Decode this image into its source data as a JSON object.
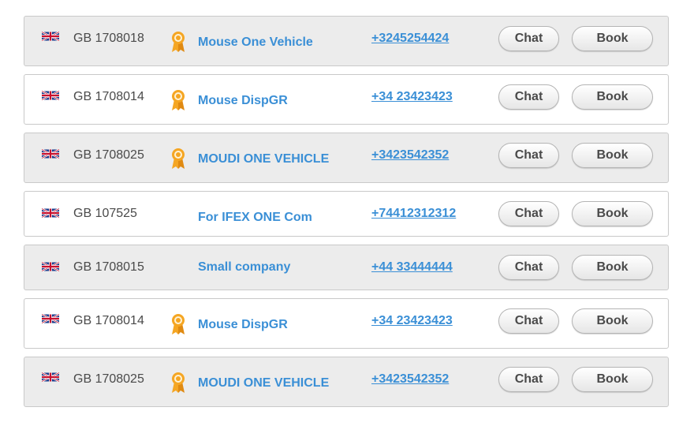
{
  "colors": {
    "link": "#3a8fd6",
    "row_gray": "#ececec",
    "row_white": "#ffffff",
    "medal": "#f5a623"
  },
  "icons": {
    "flag": "uk-flag-icon",
    "badge": "award-medal-icon"
  },
  "rows": [
    {
      "code": "GB 1708018",
      "company": "Mouse One Vehicle",
      "phone": "+3245254424",
      "has_medal": true,
      "chat_label": "Chat",
      "book_label": "Book"
    },
    {
      "code": "GB 1708014",
      "company": "Mouse DispGR",
      "phone": "+34 23423423",
      "has_medal": true,
      "chat_label": "Chat",
      "book_label": "Book"
    },
    {
      "code": "GB 1708025",
      "company": "MOUDI ONE VEHICLE",
      "phone": "+3423542352",
      "has_medal": true,
      "chat_label": "Chat",
      "book_label": "Book"
    },
    {
      "code": "GB 107525",
      "company": "For IFEX ONE Com",
      "phone": "+74412312312",
      "has_medal": false,
      "chat_label": "Chat",
      "book_label": "Book"
    },
    {
      "code": "GB 1708015",
      "company": "Small company",
      "phone": "+44 33444444",
      "has_medal": false,
      "chat_label": "Chat",
      "book_label": "Book"
    },
    {
      "code": "GB 1708014",
      "company": "Mouse DispGR",
      "phone": "+34 23423423",
      "has_medal": true,
      "chat_label": "Chat",
      "book_label": "Book"
    },
    {
      "code": "GB 1708025",
      "company": "MOUDI ONE VEHICLE",
      "phone": "+3423542352",
      "has_medal": true,
      "chat_label": "Chat",
      "book_label": "Book"
    }
  ]
}
